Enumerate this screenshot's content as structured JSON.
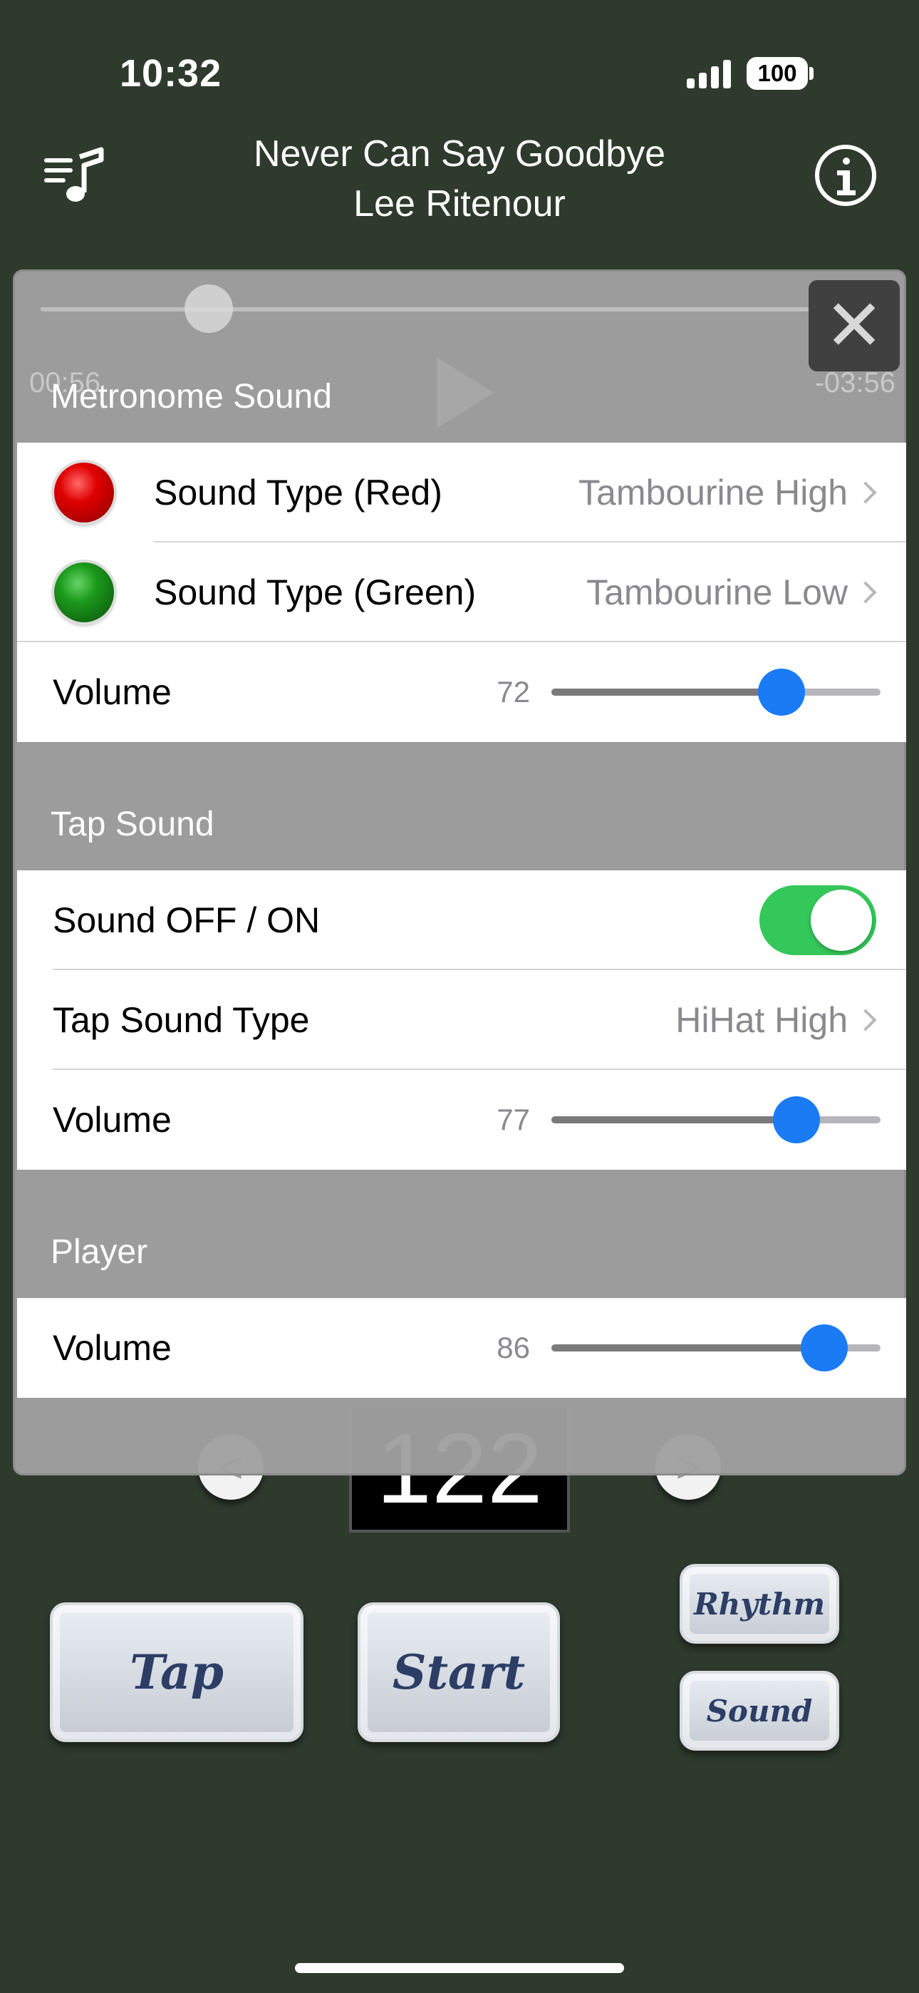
{
  "status_bar": {
    "time": "10:32",
    "battery": "100"
  },
  "header": {
    "title": "Never Can Say Goodbye",
    "artist": "Lee Ritenour",
    "playlist_icon": "music-list-icon",
    "info_icon": "info-icon"
  },
  "background": {
    "elapsed": "00:56",
    "remaining": "-03:56",
    "progress": 0.2,
    "bpm": "122",
    "prev_glyph": "<",
    "next_glyph": ">",
    "tap_label": "Tap",
    "start_label": "Start",
    "rhythm_label": "Rhythm",
    "sound_label": "Sound"
  },
  "settings": {
    "close_glyph": "✕",
    "metronome": {
      "header": "Metronome Sound",
      "red_label": "Sound Type (Red)",
      "red_value": "Tambourine High",
      "green_label": "Sound Type (Green)",
      "green_value": "Tambourine Low",
      "volume_label": "Volume",
      "volume_value": "72",
      "volume_level": 0.7
    },
    "tap": {
      "header": "Tap Sound",
      "toggle_label": "Sound OFF / ON",
      "toggle_on": true,
      "type_label": "Tap Sound Type",
      "type_value": "HiHat High",
      "volume_label": "Volume",
      "volume_value": "77",
      "volume_level": 0.745
    },
    "player": {
      "header": "Player",
      "volume_label": "Volume",
      "volume_value": "86",
      "volume_level": 0.83
    }
  },
  "colors": {
    "background": "#2d3a2c",
    "accent": "#1a7bf5",
    "toggle_on": "#34c759"
  }
}
